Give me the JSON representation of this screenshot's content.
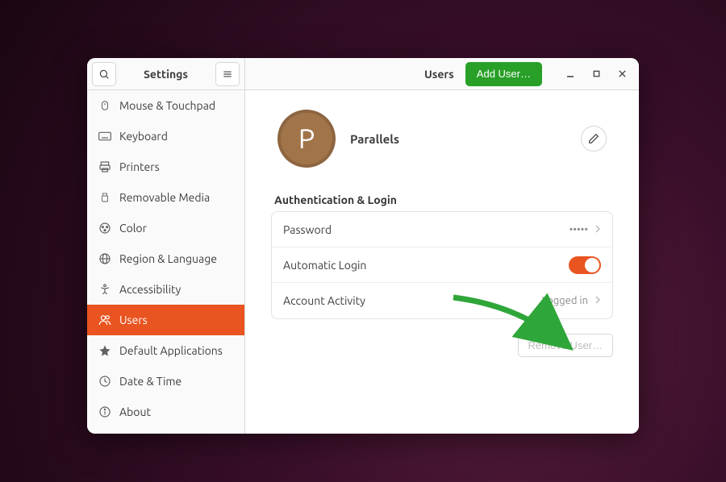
{
  "header": {
    "app_title": "Settings",
    "panel_title": "Users",
    "add_user_label": "Add User…"
  },
  "sidebar": {
    "items": [
      {
        "icon": "mouse",
        "label": "Mouse & Touchpad",
        "selected": false
      },
      {
        "icon": "keyboard",
        "label": "Keyboard",
        "selected": false
      },
      {
        "icon": "printer",
        "label": "Printers",
        "selected": false
      },
      {
        "icon": "usb",
        "label": "Removable Media",
        "selected": false
      },
      {
        "icon": "color",
        "label": "Color",
        "selected": false
      },
      {
        "icon": "globe",
        "label": "Region & Language",
        "selected": false
      },
      {
        "icon": "accessibility",
        "label": "Accessibility",
        "selected": false
      },
      {
        "icon": "users",
        "label": "Users",
        "selected": true
      },
      {
        "icon": "star",
        "label": "Default Applications",
        "selected": false
      },
      {
        "icon": "clock",
        "label": "Date & Time",
        "selected": false
      },
      {
        "icon": "info",
        "label": "About",
        "selected": false
      }
    ]
  },
  "user": {
    "initial": "P",
    "name": "Parallels",
    "avatar_color": "#a17449"
  },
  "auth_section": {
    "heading": "Authentication & Login",
    "rows": {
      "password": {
        "label": "Password",
        "value": "•••••"
      },
      "autologin": {
        "label": "Automatic Login",
        "on": true
      },
      "activity": {
        "label": "Account Activity",
        "value": "Logged in"
      }
    }
  },
  "remove_user_label": "Remove User…",
  "colors": {
    "accent": "#e95420",
    "success": "#28a028"
  }
}
